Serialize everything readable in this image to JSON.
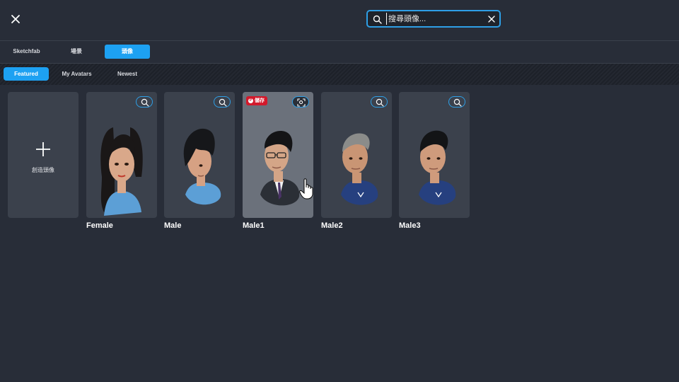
{
  "search": {
    "placeholder": "搜尋頭像..."
  },
  "source_tabs": [
    {
      "label": "Sketchfab",
      "active": false
    },
    {
      "label": "場景",
      "active": false
    },
    {
      "label": "頭像",
      "active": true
    }
  ],
  "filter_tabs": [
    {
      "label": "Featured",
      "active": true
    },
    {
      "label": "My Avatars",
      "active": false
    },
    {
      "label": "Newest",
      "active": false
    }
  ],
  "create": {
    "label": "創造頭像"
  },
  "pin": {
    "label": "儲存"
  },
  "avatars": [
    {
      "name": "Female",
      "hair": "#1a1717",
      "skin": "#d9a88a",
      "shirt": "#5c9fd6"
    },
    {
      "name": "Male",
      "hair": "#16171a",
      "skin": "#d6a183",
      "shirt": "#5c9fd6"
    },
    {
      "name": "Male1",
      "hair": "#141416",
      "skin": "#d4a587",
      "shirt": "#2b2f36"
    },
    {
      "name": "Male2",
      "hair": "#8b8c8a",
      "skin": "#c99574",
      "shirt": "#26407f"
    },
    {
      "name": "Male3",
      "hair": "#131416",
      "skin": "#cf9b7c",
      "shirt": "#26407f"
    }
  ],
  "colors": {
    "accent": "#1da1f2",
    "pin": "#d3192b",
    "background": "#282d38",
    "card": "#3b414c"
  }
}
